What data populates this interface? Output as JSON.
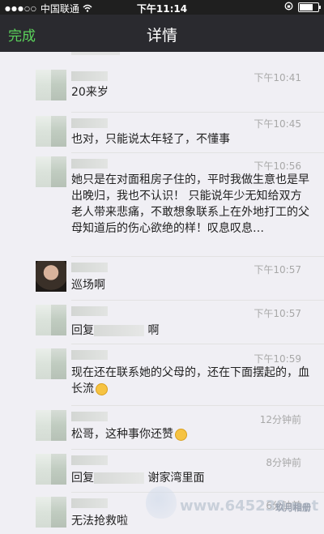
{
  "status_bar": {
    "carrier": "中国联通",
    "time": "下午11:14"
  },
  "nav": {
    "done_label": "完成",
    "title": "详情"
  },
  "messages": [
    {
      "time": "下午10:41",
      "text": "20来岁"
    },
    {
      "time": "下午10:45",
      "text": "也对，只能说太年轻了，不懂事"
    },
    {
      "time": "下午10:56",
      "text": "她只是在对面租房子住的，平时我做生意也是早出晚归，我也不认识！ 只能说年少无知给双方老人带来悲痛，不敢想象联系上在外地打工的父母知道后的伤心欲绝的样！叹息叹息…"
    },
    {
      "time": "下午10:57",
      "text": "巡场啊"
    },
    {
      "time": "下午10:57",
      "text_before": "回复",
      "text_after": "啊"
    },
    {
      "time": "下午10:59",
      "text": "现在还在联系她的父母的，还在下面摆起的，血长流"
    },
    {
      "time": "12分钟前",
      "text": "松哥，这种事你还赞"
    },
    {
      "time": "8分钟前",
      "text_before": "回复",
      "text_after": "谢家湾里面"
    },
    {
      "time": "6分钟前",
      "text": "无法抢救啦"
    }
  ],
  "watermark": {
    "site": "www.645230.net",
    "wx": "玖月相册"
  },
  "colors": {
    "nav_bg": "#2a2a2f",
    "done_green": "#5bd35b",
    "page_bg": "#f0eff4",
    "time_gray": "#a8a8a8"
  },
  "icons": [
    "wifi-icon",
    "lock-rotation-icon",
    "battery-icon",
    "signal-icon"
  ]
}
